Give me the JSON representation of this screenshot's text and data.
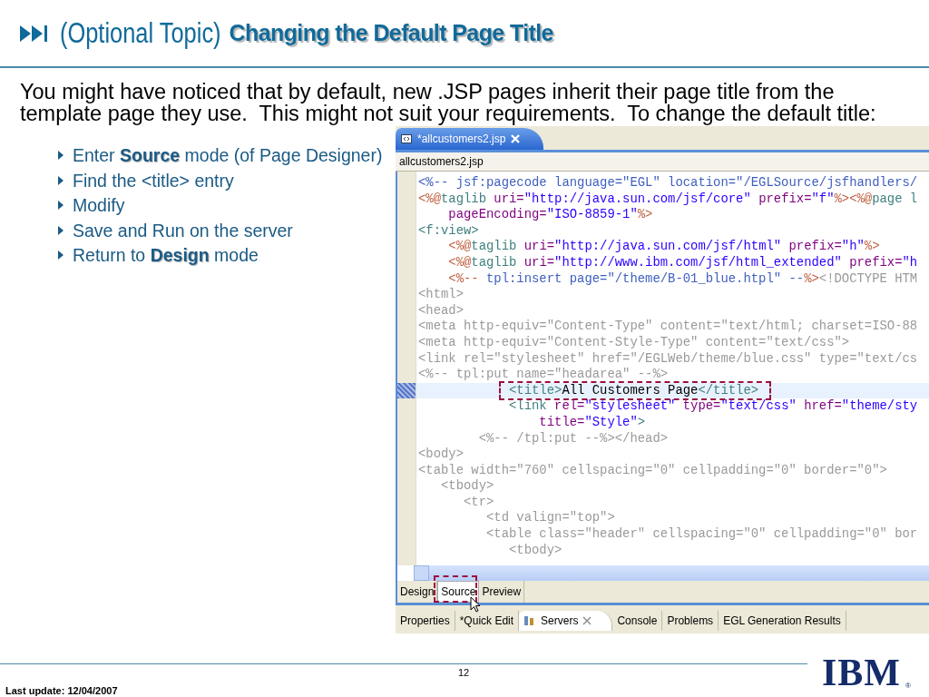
{
  "slide": {
    "title_prefix": "(Optional Topic)",
    "title": "Changing the Default Page Title",
    "intro": "You might have noticed that by default, new .JSP pages inherit their page title from the template page they use.  This might not suit your requirements.  To change the default title:",
    "bullets": [
      "Enter **Source** mode (of Page Designer)",
      "Find the <title> entry",
      "Modify",
      "Save and Run on the server",
      "Return to **Design** mode"
    ]
  },
  "editor": {
    "file_tabs": [
      {
        "label": "*allcustomers2.jsp",
        "selected": true
      }
    ],
    "breadcrumb": "allcustomers2.jsp",
    "lines": [
      {
        "current": false,
        "segments": [
          {
            "kind": "comment",
            "text": "<%-- jsf:pagecode language=\"EGL\" location=\"/EGLSource/jsfhandlers/"
          }
        ]
      },
      {
        "current": false,
        "segments": [
          {
            "kind": "delim",
            "text": "<%@"
          },
          {
            "kind": "tag",
            "text": "taglib"
          },
          {
            "kind": "attr",
            "text": " uri="
          },
          {
            "kind": "value",
            "text": "\"http://java.sun.com/jsf/core\""
          },
          {
            "kind": "attr",
            "text": " prefix="
          },
          {
            "kind": "value",
            "text": "\"f\""
          },
          {
            "kind": "delim",
            "text": "%><%@"
          },
          {
            "kind": "tag",
            "text": "page l"
          }
        ]
      },
      {
        "current": false,
        "segments": [
          {
            "kind": "attr",
            "text": "    pageEncoding="
          },
          {
            "kind": "value",
            "text": "\"ISO-8859-1\""
          },
          {
            "kind": "delim",
            "text": "%>"
          }
        ]
      },
      {
        "current": false,
        "segments": [
          {
            "kind": "tag",
            "text": "<f:view>"
          }
        ]
      },
      {
        "current": false,
        "segments": [
          {
            "kind": "delim",
            "text": "    <%@"
          },
          {
            "kind": "tag",
            "text": "taglib"
          },
          {
            "kind": "attr",
            "text": " uri="
          },
          {
            "kind": "value",
            "text": "\"http://java.sun.com/jsf/html\""
          },
          {
            "kind": "attr",
            "text": " prefix="
          },
          {
            "kind": "value",
            "text": "\"h\""
          },
          {
            "kind": "delim",
            "text": "%>"
          }
        ]
      },
      {
        "current": false,
        "segments": [
          {
            "kind": "delim",
            "text": "    <%@"
          },
          {
            "kind": "tag",
            "text": "taglib"
          },
          {
            "kind": "attr",
            "text": " uri="
          },
          {
            "kind": "value",
            "text": "\"http://www.ibm.com/jsf/html_extended\""
          },
          {
            "kind": "attr",
            "text": " prefix="
          },
          {
            "kind": "value",
            "text": "\"h"
          }
        ]
      },
      {
        "current": false,
        "segments": [
          {
            "kind": "delim",
            "text": "    <%--"
          },
          {
            "kind": "comment",
            "text": " tpl:insert page=\"/theme/B-01_blue.htpl\" --"
          },
          {
            "kind": "delim",
            "text": "%>"
          },
          {
            "kind": "grey",
            "text": "<!DOCTYPE HTM"
          }
        ]
      },
      {
        "current": false,
        "segments": [
          {
            "kind": "grey",
            "text": "<html>"
          }
        ]
      },
      {
        "current": false,
        "segments": [
          {
            "kind": "grey",
            "text": "<head>"
          }
        ]
      },
      {
        "current": false,
        "segments": [
          {
            "kind": "grey",
            "text": "<meta http-equiv=\"Content-Type\" content=\"text/html; charset=ISO-88"
          }
        ]
      },
      {
        "current": false,
        "segments": [
          {
            "kind": "grey",
            "text": "<meta http-equiv=\"Content-Style-Type\" content=\"text/css\">"
          }
        ]
      },
      {
        "current": false,
        "segments": [
          {
            "kind": "grey",
            "text": "<link rel=\"stylesheet\" href=\"/EGLWeb/theme/blue.css\" type=\"text/cs"
          }
        ]
      },
      {
        "current": false,
        "segments": [
          {
            "kind": "grey",
            "text": "<%-- tpl:put name=\"headarea\" --%>"
          }
        ]
      },
      {
        "current": true,
        "segments": [
          {
            "kind": "tag",
            "text": "            <title>"
          },
          {
            "kind": "text",
            "text": "All Customers Page"
          },
          {
            "kind": "tag",
            "text": "</title>"
          }
        ]
      },
      {
        "current": false,
        "segments": [
          {
            "kind": "tag",
            "text": "            <link"
          },
          {
            "kind": "attr",
            "text": " rel="
          },
          {
            "kind": "value",
            "text": "\"stylesheet\""
          },
          {
            "kind": "attr",
            "text": " type="
          },
          {
            "kind": "value",
            "text": "\"text/css\""
          },
          {
            "kind": "attr",
            "text": " href="
          },
          {
            "kind": "value",
            "text": "\"theme/sty"
          }
        ]
      },
      {
        "current": false,
        "segments": [
          {
            "kind": "attr",
            "text": "                title="
          },
          {
            "kind": "value",
            "text": "\"Style\""
          },
          {
            "kind": "tag",
            "text": ">"
          }
        ]
      },
      {
        "current": false,
        "segments": [
          {
            "kind": "grey",
            "text": "        <%-- /tpl:put --%></head>"
          }
        ]
      },
      {
        "current": false,
        "segments": [
          {
            "kind": "grey",
            "text": "<body>"
          }
        ]
      },
      {
        "current": false,
        "segments": [
          {
            "kind": "grey",
            "text": "<table width=\"760\" cellspacing=\"0\" cellpadding=\"0\" border=\"0\">"
          }
        ]
      },
      {
        "current": false,
        "segments": [
          {
            "kind": "grey",
            "text": "   <tbody>"
          }
        ]
      },
      {
        "current": false,
        "segments": [
          {
            "kind": "grey",
            "text": "      <tr>"
          }
        ]
      },
      {
        "current": false,
        "segments": [
          {
            "kind": "grey",
            "text": "         <td valign=\"top\">"
          }
        ]
      },
      {
        "current": false,
        "segments": [
          {
            "kind": "grey",
            "text": "         <table class=\"header\" cellspacing=\"0\" cellpadding=\"0\" bor"
          }
        ]
      },
      {
        "current": false,
        "segments": [
          {
            "kind": "grey",
            "text": "            <tbody>"
          }
        ]
      }
    ],
    "mode_tabs": [
      {
        "label": "Design",
        "selected": false
      },
      {
        "label": "Source",
        "selected": true
      },
      {
        "label": "Preview",
        "selected": false
      }
    ],
    "view_tabs": [
      {
        "label": "Properties",
        "selected": false
      },
      {
        "label": "*Quick Edit",
        "selected": false
      },
      {
        "label": "Servers",
        "selected": true
      },
      {
        "label": "Console",
        "selected": false
      },
      {
        "label": "Problems",
        "selected": false
      },
      {
        "label": "EGL Generation Results",
        "selected": false
      }
    ]
  },
  "footer": {
    "last_update": "Last update: 12/04/2007",
    "page_number": "12",
    "logo": "IBM",
    "logo_mark": "®"
  }
}
